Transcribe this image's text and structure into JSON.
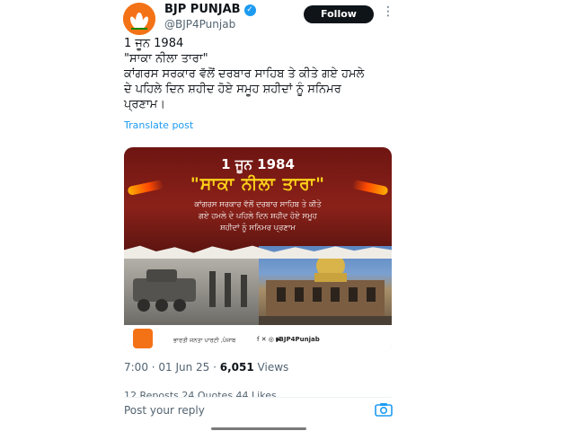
{
  "author": {
    "name": "BJP PUNJAB",
    "handle": "@BJP4Punjab",
    "follow_label": "Follow",
    "more_glyph": "⋮"
  },
  "tweet": {
    "lines": [
      "1 ਜੂਨ 1984",
      "\"ਸਾਕਾ ਨੀਲਾ ਤਾਰਾ\"",
      "ਕਾਂਗਰਸ ਸਰਕਾਰ ਵੱਲੋਂ ਦਰਬਾਰ ਸਾਹਿਬ ਤੇ ਕੀਤੇ ਗਏ ਹਮਲੇ",
      "ਦੇ ਪਹਿਲੇ ਦਿਨ ਸ਼ਹੀਦ ਹੋਏ ਸਮੂਹ ਸ਼ਹੀਦਾਂ ਨੂੰ ਸਨਿਮਰ",
      "ਪ੍ਰਣਾਮ।"
    ],
    "translate_label": "Translate post"
  },
  "image": {
    "date": "1 ਜੂਨ 1984",
    "title": "\"ਸਾਕਾ ਨੀਲਾ ਤਾਰਾ\"",
    "subtitle_lines": [
      "ਕਾਂਗਰਸ ਸਰਕਾਰ ਵੱਲੋਂ ਦਰਬਾਰ ਸਾਹਿਬ ਤੇ ਕੀਤੇ",
      "ਗਏ ਹਮਲੇ ਦੇ ਪਹਿਲੇ ਦਿਨ ਸ਼ਹੀਦ ਹੋਏ ਸਮੂਹ",
      "ਸ਼ਹੀਦਾਂ ਨੂੰ ਸਨਿਮਰ ਪ੍ਰਣਾਮ"
    ],
    "footer_party": "ਭਾਰਤੀ ਜਨਤਾ ਪਾਰਟੀ ,ਪੰਜਾਬ",
    "footer_social": "f ✕ ◎ ▶",
    "footer_handle": "/BJP4Punjab"
  },
  "meta": {
    "time": "7:00 · 01 Jun 25 · ",
    "views_count": "6,051",
    "views_label": " Views"
  },
  "stats_partial": "12 Reposts   24 Quotes   44 Likes",
  "reply_placeholder": "Post your reply",
  "colors": {
    "brand_orange": "#f47216",
    "link_blue": "#1d9bf0",
    "poster_red": "#8a2119",
    "poster_yellow": "#ffd21a"
  },
  "icons": [
    "verified-badge-icon",
    "more-options-icon",
    "camera-icon",
    "lotus-logo-icon"
  ]
}
